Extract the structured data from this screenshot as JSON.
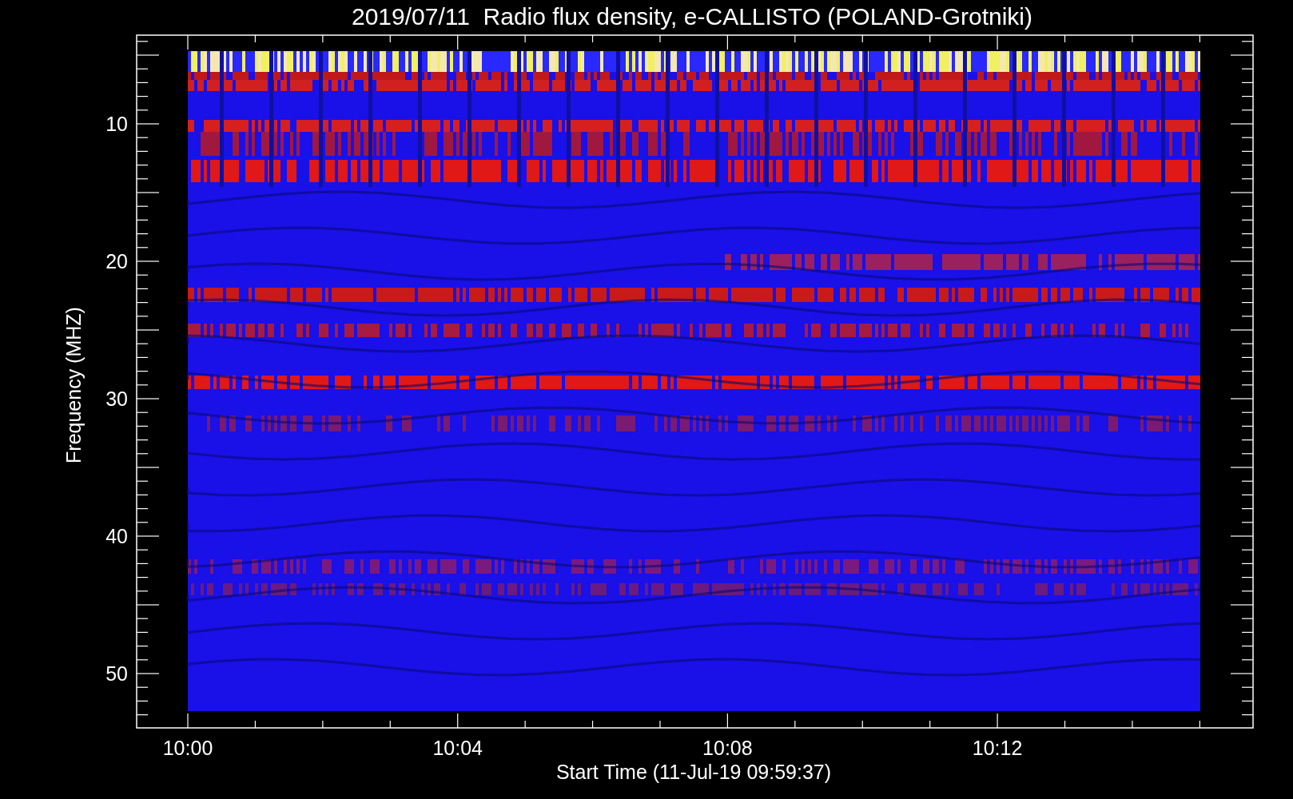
{
  "plot": {
    "title": "2019/07/11  Radio flux density, e-CALLISTO (POLAND-Grotniki)",
    "xlabel": "Start Time (11-Jul-19 09:59:37)",
    "ylabel": "Frequency (MHZ)",
    "xticks": [
      "10:00",
      "10:04",
      "10:08",
      "10:12"
    ],
    "yticks": [
      "10",
      "20",
      "30",
      "40",
      "50"
    ]
  }
}
